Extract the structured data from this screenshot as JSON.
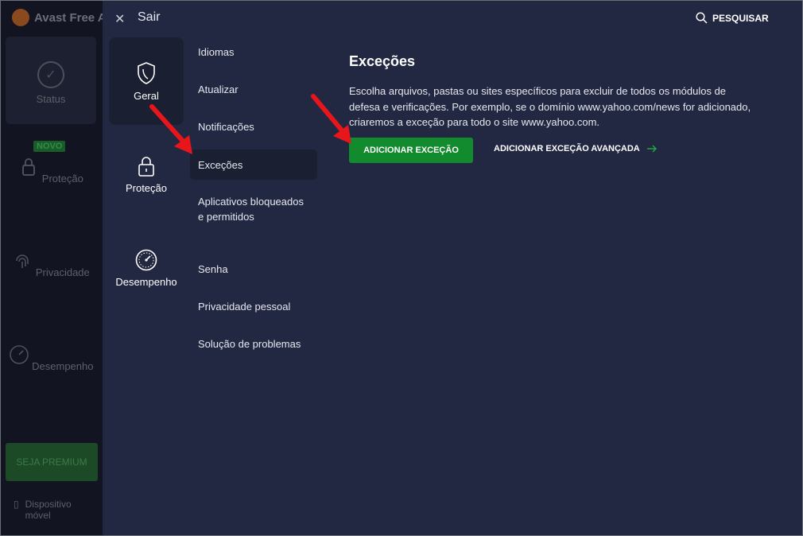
{
  "bg_app": {
    "title": "Avast Free A",
    "nav": [
      {
        "label": "Status",
        "icon": "check-circle-icon"
      },
      {
        "label": "Proteção",
        "icon": "lock-icon",
        "badge": "NOVO"
      },
      {
        "label": "Privacidade",
        "icon": "fingerprint-icon"
      },
      {
        "label": "Desempenho",
        "icon": "speedometer-icon"
      }
    ],
    "premium": "SEJA PREMIUM",
    "mobile": "Dispositivo móvel"
  },
  "topbar": {
    "close_label": "Sair",
    "search_label": "PESQUISAR"
  },
  "categories": [
    {
      "label": "Geral",
      "icon": "shield-icon",
      "active": true
    },
    {
      "label": "Proteção",
      "icon": "lock-icon",
      "active": false
    },
    {
      "label": "Desempenho",
      "icon": "speedometer-icon",
      "active": false
    }
  ],
  "subnav": [
    {
      "label": "Idiomas"
    },
    {
      "label": "Atualizar"
    },
    {
      "label": "Notificações"
    },
    {
      "label": "Exceções",
      "active": true
    },
    {
      "label": "Aplicativos bloqueados e permitidos"
    },
    {
      "label": "Senha"
    },
    {
      "label": "Privacidade pessoal"
    },
    {
      "label": "Solução de problemas"
    }
  ],
  "content": {
    "title": "Exceções",
    "description": "Escolha arquivos, pastas ou sites específicos para excluir de todos os módulos de defesa e verificações. Por exemplo, se o domínio www.yahoo.com/news for adicionado, criaremos a exceção para todo o site www.yahoo.com.",
    "add_button": "ADICIONAR EXCEÇÃO",
    "advanced_link": "ADICIONAR EXCEÇÃO AVANÇADA"
  },
  "colors": {
    "accent_green": "#128b2e",
    "annotation_red": "#e8151b",
    "panel_bg": "#232842"
  }
}
